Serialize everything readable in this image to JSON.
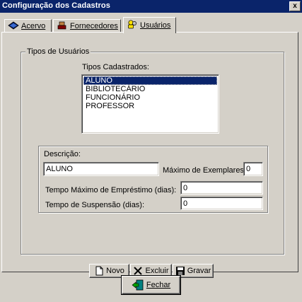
{
  "window": {
    "title": "Configuração dos Cadastros",
    "close_glyph": "x"
  },
  "tabs": [
    {
      "label": "Acervo",
      "icon": "book-icon",
      "active": false
    },
    {
      "label": "Fornecedores",
      "icon": "supplier-icon",
      "active": false
    },
    {
      "label": "Usuários",
      "icon": "users-icon",
      "active": true
    }
  ],
  "user_types": {
    "group_label": "Tipos de Usuários",
    "list_label": "Tipos Cadastrados:",
    "items": [
      "ALUNO",
      "BIBLIOTECÁRIO",
      "FUNCIONÁRIO",
      "PROFESSOR"
    ],
    "selected": "ALUNO"
  },
  "form": {
    "description_label": "Descrição:",
    "description_value": "ALUNO",
    "max_copies_label": "Máximo de Exemplares:",
    "max_copies_value": "0",
    "max_loan_label": "Tempo Máximo de Empréstimo (dias):",
    "max_loan_value": "0",
    "suspension_label": "Tempo de Suspensão (dias):",
    "suspension_value": "0"
  },
  "actions": {
    "new_label": "Novo",
    "delete_label": "Excluir",
    "save_label": "Gravar"
  },
  "footer": {
    "close_label": "Fechar"
  },
  "colors": {
    "titlebar": "#0a246a",
    "face": "#d4d0c8",
    "selection": "#0a246a"
  }
}
